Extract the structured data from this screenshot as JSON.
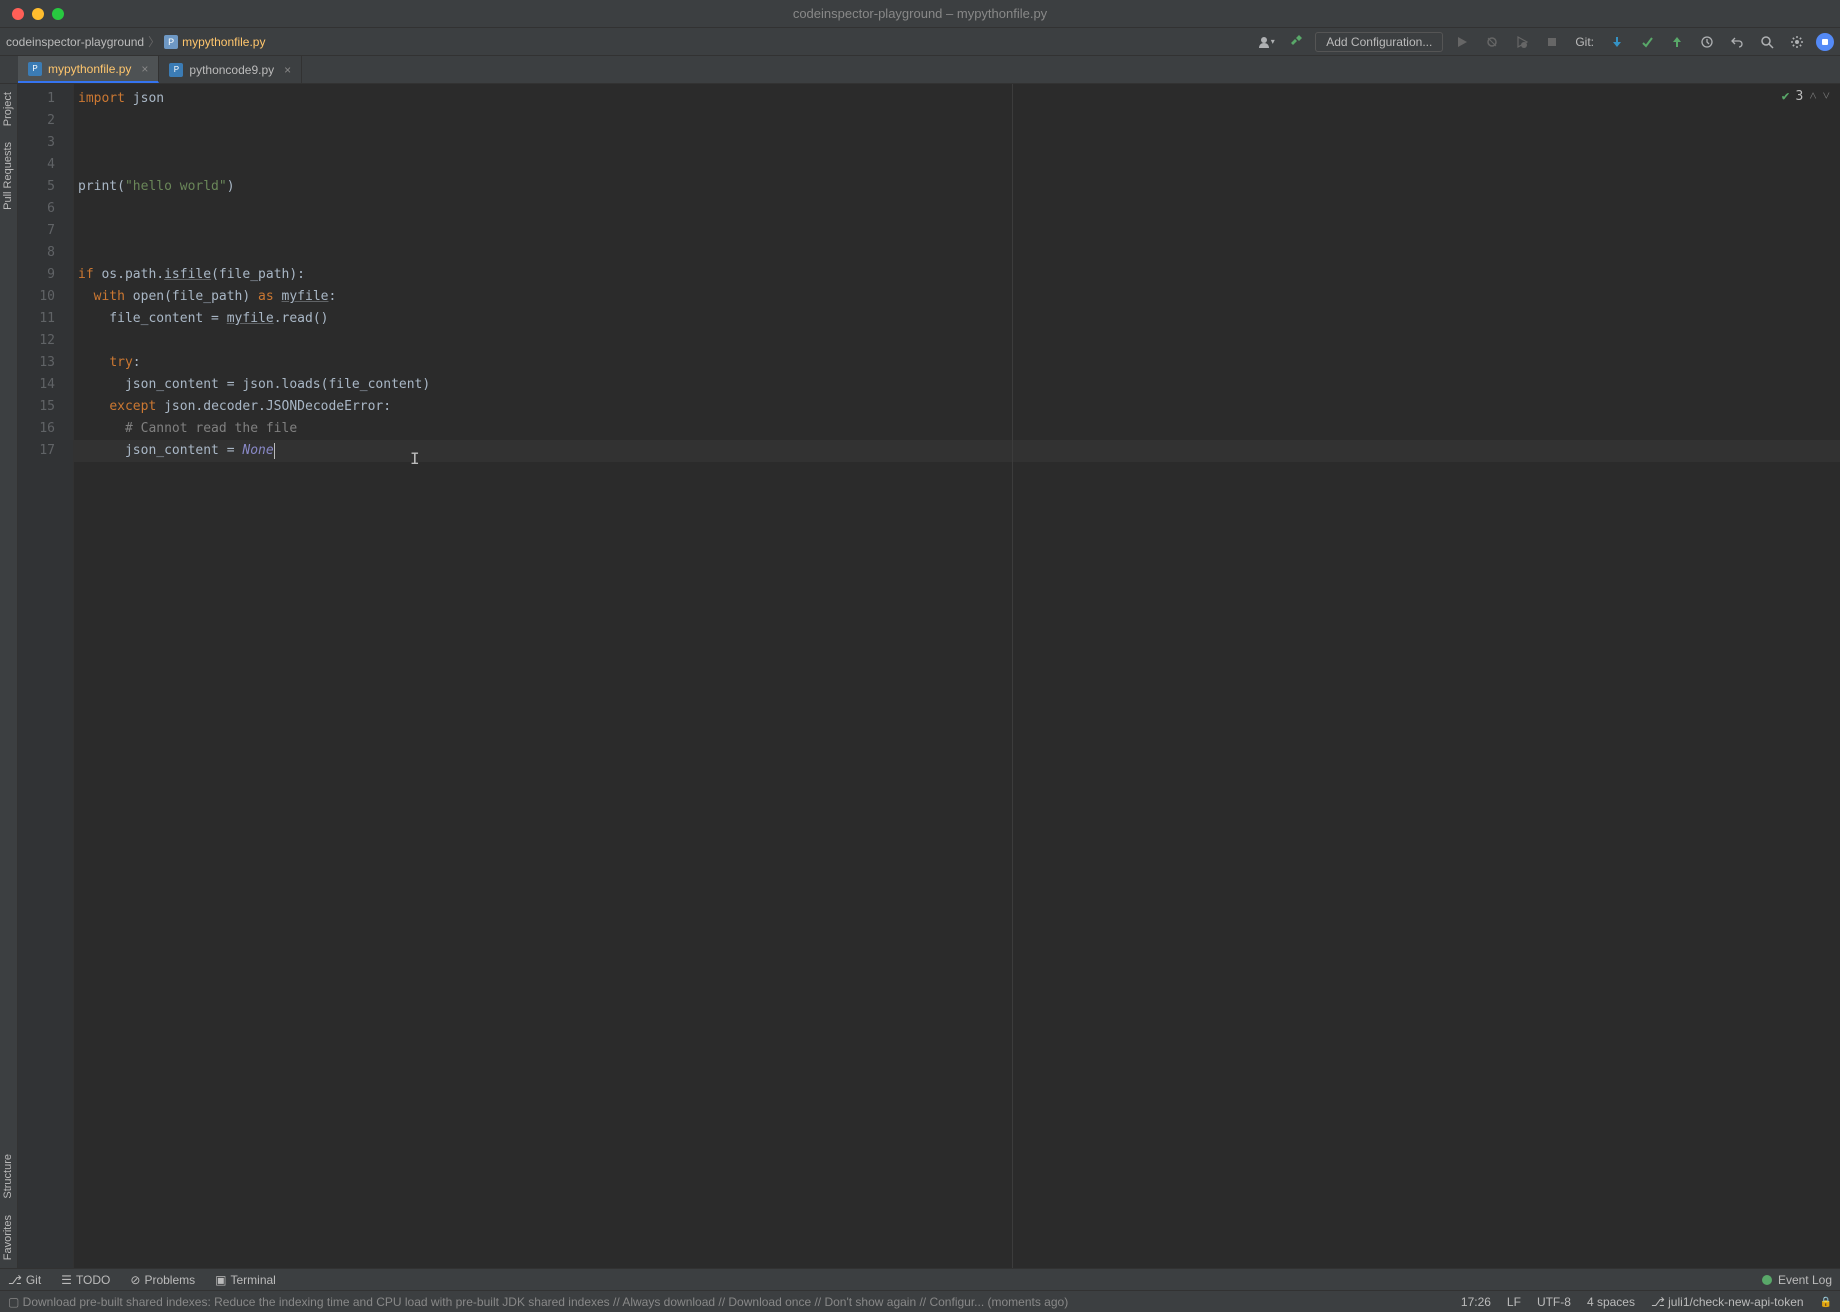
{
  "window_title": "codeinspector-playground – mypythonfile.py",
  "breadcrumb": {
    "project": "codeinspector-playground",
    "file": "mypythonfile.py"
  },
  "toolbar": {
    "config_label": "Add Configuration...",
    "git_label": "Git:"
  },
  "tabs": [
    {
      "label": "mypythonfile.py",
      "active": true
    },
    {
      "label": "pythoncode9.py",
      "active": false
    }
  ],
  "inspection": {
    "count": "3"
  },
  "code": {
    "lines": [
      {
        "n": 1,
        "tokens": [
          {
            "t": "import ",
            "c": "kw"
          },
          {
            "t": "json",
            "c": "def"
          }
        ]
      },
      {
        "n": 2,
        "tokens": []
      },
      {
        "n": 3,
        "tokens": []
      },
      {
        "n": 4,
        "tokens": []
      },
      {
        "n": 5,
        "tokens": [
          {
            "t": "print(",
            "c": "def"
          },
          {
            "t": "\"hello world\"",
            "c": "str"
          },
          {
            "t": ")",
            "c": "def"
          }
        ]
      },
      {
        "n": 6,
        "tokens": []
      },
      {
        "n": 7,
        "tokens": []
      },
      {
        "n": 8,
        "tokens": []
      },
      {
        "n": 9,
        "tokens": [
          {
            "t": "if ",
            "c": "kw"
          },
          {
            "t": "os.path.",
            "c": "def"
          },
          {
            "t": "isfile",
            "c": "ident-u"
          },
          {
            "t": "(file_path):",
            "c": "def"
          }
        ]
      },
      {
        "n": 10,
        "tokens": [
          {
            "t": "  ",
            "c": ""
          },
          {
            "t": "with ",
            "c": "kw"
          },
          {
            "t": "open(file_path) ",
            "c": "def"
          },
          {
            "t": "as ",
            "c": "kw"
          },
          {
            "t": "myfile",
            "c": "ident-u"
          },
          {
            "t": ":",
            "c": "def"
          }
        ]
      },
      {
        "n": 11,
        "tokens": [
          {
            "t": "    file_content = ",
            "c": "def"
          },
          {
            "t": "myfile",
            "c": "ident-u"
          },
          {
            "t": ".read()",
            "c": "def"
          }
        ]
      },
      {
        "n": 12,
        "tokens": []
      },
      {
        "n": 13,
        "tokens": [
          {
            "t": "    ",
            "c": ""
          },
          {
            "t": "try",
            "c": "kw"
          },
          {
            "t": ":",
            "c": "def"
          }
        ]
      },
      {
        "n": 14,
        "tokens": [
          {
            "t": "      json_content = json.loads(file_content)",
            "c": "def"
          }
        ]
      },
      {
        "n": 15,
        "tokens": [
          {
            "t": "    ",
            "c": ""
          },
          {
            "t": "except ",
            "c": "kw"
          },
          {
            "t": "json.decoder.JSONDecodeError:",
            "c": "def"
          }
        ]
      },
      {
        "n": 16,
        "tokens": [
          {
            "t": "      ",
            "c": ""
          },
          {
            "t": "# Cannot read the file",
            "c": "comment"
          }
        ]
      },
      {
        "n": 17,
        "tokens": [
          {
            "t": "      json_content = ",
            "c": "def"
          },
          {
            "t": "None",
            "c": "builtin"
          }
        ],
        "current": true
      }
    ]
  },
  "left_sidebar": {
    "project": "Project",
    "pull_requests": "Pull Requests",
    "structure": "Structure",
    "favorites": "Favorites"
  },
  "bottom_tools": {
    "git": "Git",
    "todo": "TODO",
    "problems": "Problems",
    "terminal": "Terminal",
    "event_log": "Event Log"
  },
  "statusbar": {
    "message": "Download pre-built shared indexes: Reduce the indexing time and CPU load with pre-built JDK shared indexes // Always download // Download once // Don't show again // Configur... (moments ago)",
    "position": "17:26",
    "line_sep": "LF",
    "encoding": "UTF-8",
    "indent": "4 spaces",
    "branch": "juli1/check-new-api-token"
  }
}
